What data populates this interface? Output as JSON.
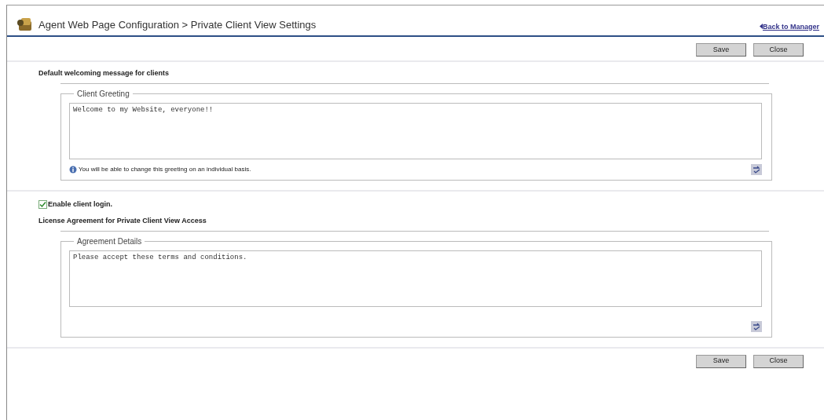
{
  "header": {
    "title": "Agent Web Page Configuration > Private Client View Settings",
    "back_link": "Back to Manager"
  },
  "top_buttons": [
    "Save",
    "Close"
  ],
  "greeting_section": {
    "heading": "Default welcoming message for clients",
    "legend": "Client Greeting",
    "value": "Welcome to my Website, everyone!!",
    "note": "You will be able to change this greeting on an individual basis."
  },
  "client_login": {
    "label": "Enable client login.",
    "checked": true
  },
  "agreement_section": {
    "heading": "License Agreement for Private Client View Access",
    "legend": "Agreement Details",
    "value": "Please accept these terms and conditions."
  },
  "bottom_buttons": [
    "Save",
    "Close"
  ]
}
